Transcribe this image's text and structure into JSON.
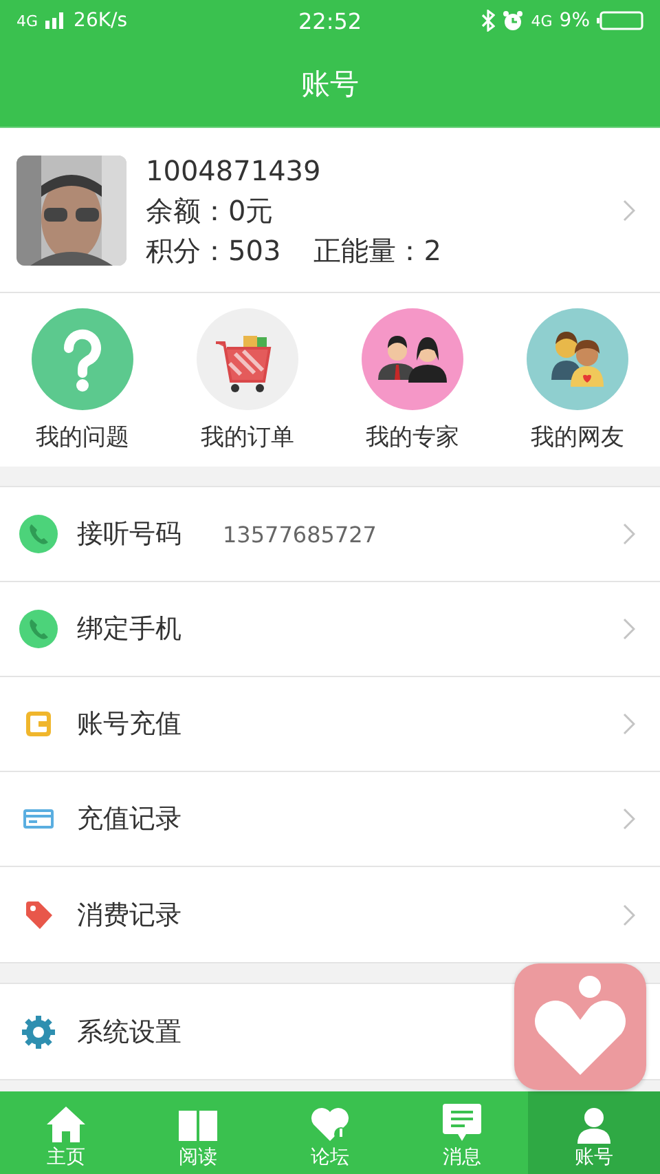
{
  "status_bar": {
    "network": "4G",
    "speed": "26K/s",
    "time": "22:52",
    "network_right": "4G",
    "battery": "9%"
  },
  "title": "账号",
  "profile": {
    "user_id": "1004871439",
    "balance": "余额：0元",
    "points": "积分：503",
    "energy": "正能量：2"
  },
  "shortcuts": [
    {
      "kind": "question",
      "label": "我的问题"
    },
    {
      "kind": "cart",
      "label": "我的订单"
    },
    {
      "kind": "experts",
      "label": "我的专家"
    },
    {
      "kind": "friends",
      "label": "我的网友"
    }
  ],
  "menu_groups": [
    [
      {
        "kind": "phone",
        "label": "接听号码",
        "value": "13577685727"
      },
      {
        "kind": "phone",
        "label": "绑定手机"
      },
      {
        "kind": "wallet",
        "label": "账号充值"
      },
      {
        "kind": "card",
        "label": "充值记录"
      },
      {
        "kind": "tag",
        "label": "消费记录"
      }
    ],
    [
      {
        "kind": "gear",
        "label": "系统设置"
      }
    ]
  ],
  "tabs": [
    {
      "kind": "home",
      "label": "主页",
      "selected": false
    },
    {
      "kind": "book",
      "label": "阅读",
      "selected": false
    },
    {
      "kind": "forum",
      "label": "论坛",
      "selected": false
    },
    {
      "kind": "message",
      "label": "消息",
      "selected": false
    },
    {
      "kind": "account",
      "label": "账号",
      "selected": true
    }
  ]
}
